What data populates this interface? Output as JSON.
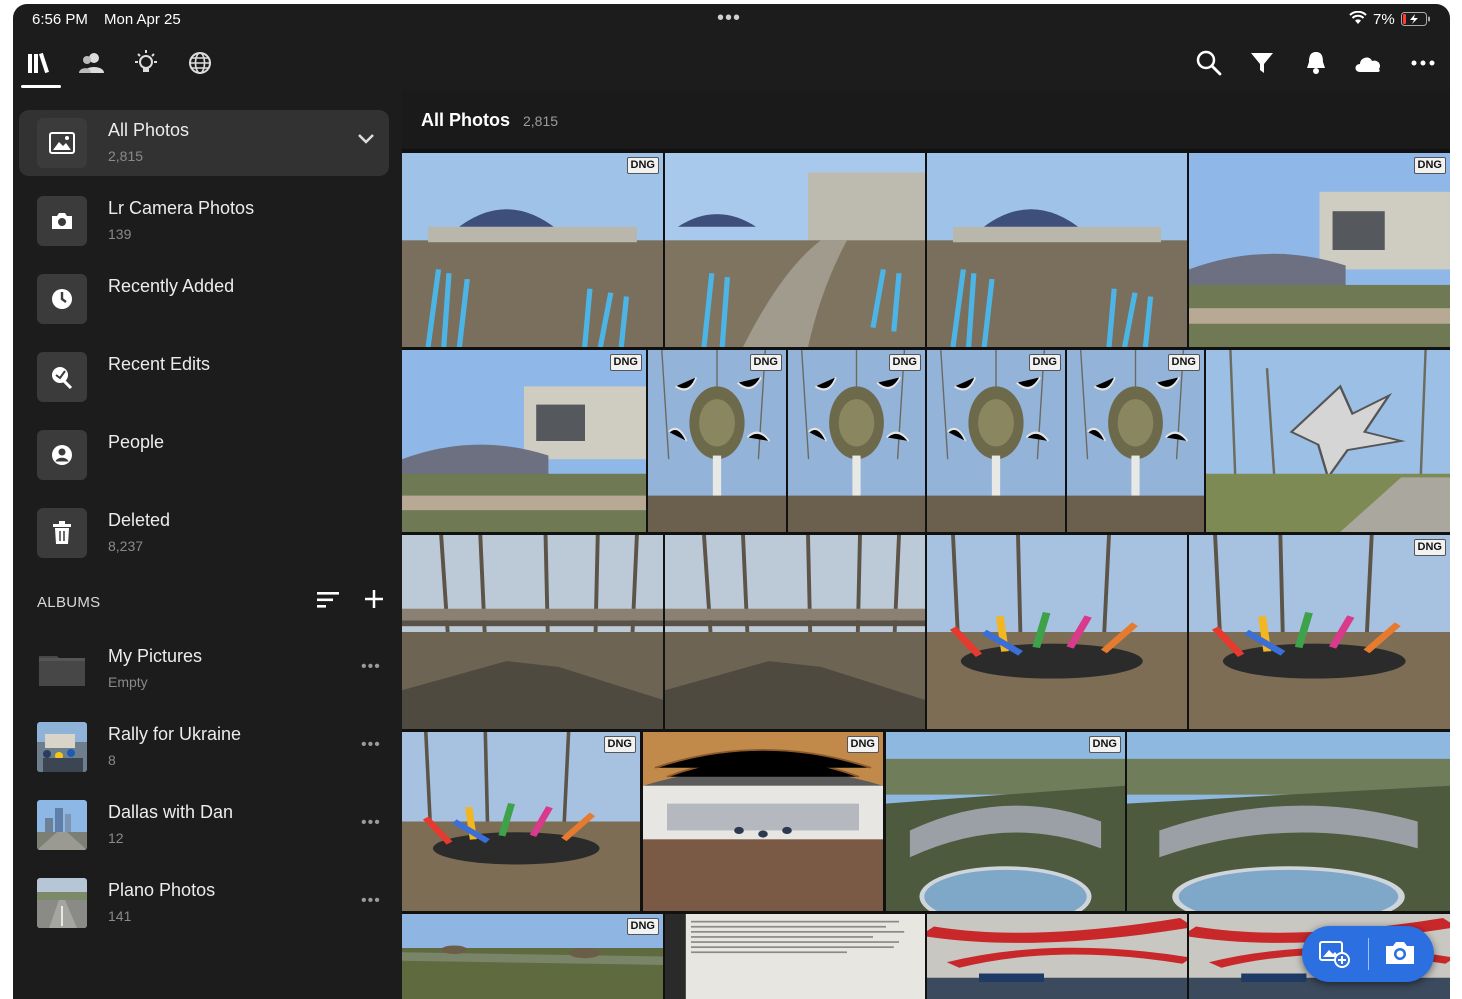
{
  "status_bar": {
    "time": "6:56 PM",
    "date": "Mon Apr 25",
    "dots": "•••",
    "battery_percent": "7%"
  },
  "top_nav": {
    "tabs": [
      {
        "name": "library-icon",
        "active": true
      },
      {
        "name": "people-icon",
        "active": false
      },
      {
        "name": "learn-icon",
        "active": false
      },
      {
        "name": "discover-icon",
        "active": false
      }
    ],
    "actions": [
      "search-icon",
      "filter-icon",
      "bell-icon",
      "cloud-icon",
      "more-icon"
    ]
  },
  "sidebar": {
    "sources": [
      {
        "label": "All Photos",
        "count": "2,815",
        "icon": "photo-icon",
        "selected": true
      },
      {
        "label": "Lr Camera Photos",
        "count": "139",
        "icon": "camera-icon"
      },
      {
        "label": "Recently Added",
        "count": "",
        "icon": "clock-icon"
      },
      {
        "label": "Recent Edits",
        "count": "",
        "icon": "edits-icon"
      },
      {
        "label": "People",
        "count": "",
        "icon": "person-icon"
      },
      {
        "label": "Deleted",
        "count": "8,237",
        "icon": "trash-icon"
      }
    ],
    "albums_header": "ALBUMS",
    "albums": [
      {
        "label": "My Pictures",
        "count": "Empty",
        "more": "•••"
      },
      {
        "label": "Rally for Ukraine",
        "count": "8",
        "more": "•••"
      },
      {
        "label": "Dallas with Dan",
        "count": "12",
        "more": "•••"
      },
      {
        "label": "Plano Photos",
        "count": "141",
        "more": "•••"
      }
    ]
  },
  "grid": {
    "title": "All Photos",
    "count": "2,815",
    "badge": "DNG",
    "photos": [
      {
        "scene": "building-blue-glass",
        "dng": true
      },
      {
        "scene": "building-creek",
        "dng": false
      },
      {
        "scene": "building-blue-glass",
        "dng": false
      },
      {
        "scene": "museum-lawn",
        "dng": true
      },
      {
        "scene": "museum-lawn",
        "dng": true
      },
      {
        "scene": "chandelier-sculpture",
        "dng": true
      },
      {
        "scene": "chandelier-sculpture",
        "dng": true
      },
      {
        "scene": "chandelier-sculpture",
        "dng": true
      },
      {
        "scene": "chandelier-sculpture",
        "dng": true
      },
      {
        "scene": "silver-sculpture",
        "dng": false
      },
      {
        "scene": "bridge-woods",
        "dng": false
      },
      {
        "scene": "bridge-woods",
        "dng": false
      },
      {
        "scene": "glass-garden",
        "dng": false
      },
      {
        "scene": "glass-garden",
        "dng": true
      },
      {
        "scene": "glass-garden",
        "dng": true
      },
      {
        "scene": "wooden-hall",
        "dng": true
      },
      {
        "scene": "aerial-roof",
        "dng": true
      },
      {
        "scene": "aerial-roof",
        "dng": false
      },
      {
        "scene": "river-valley",
        "dng": true
      },
      {
        "scene": "document",
        "dng": false
      },
      {
        "scene": "red-ceiling",
        "dng": false
      },
      {
        "scene": "red-ceiling",
        "dng": false
      }
    ]
  },
  "colors": {
    "accent": "#2c6fe0",
    "background": "#1c1c1c",
    "selected_row": "#323232"
  }
}
